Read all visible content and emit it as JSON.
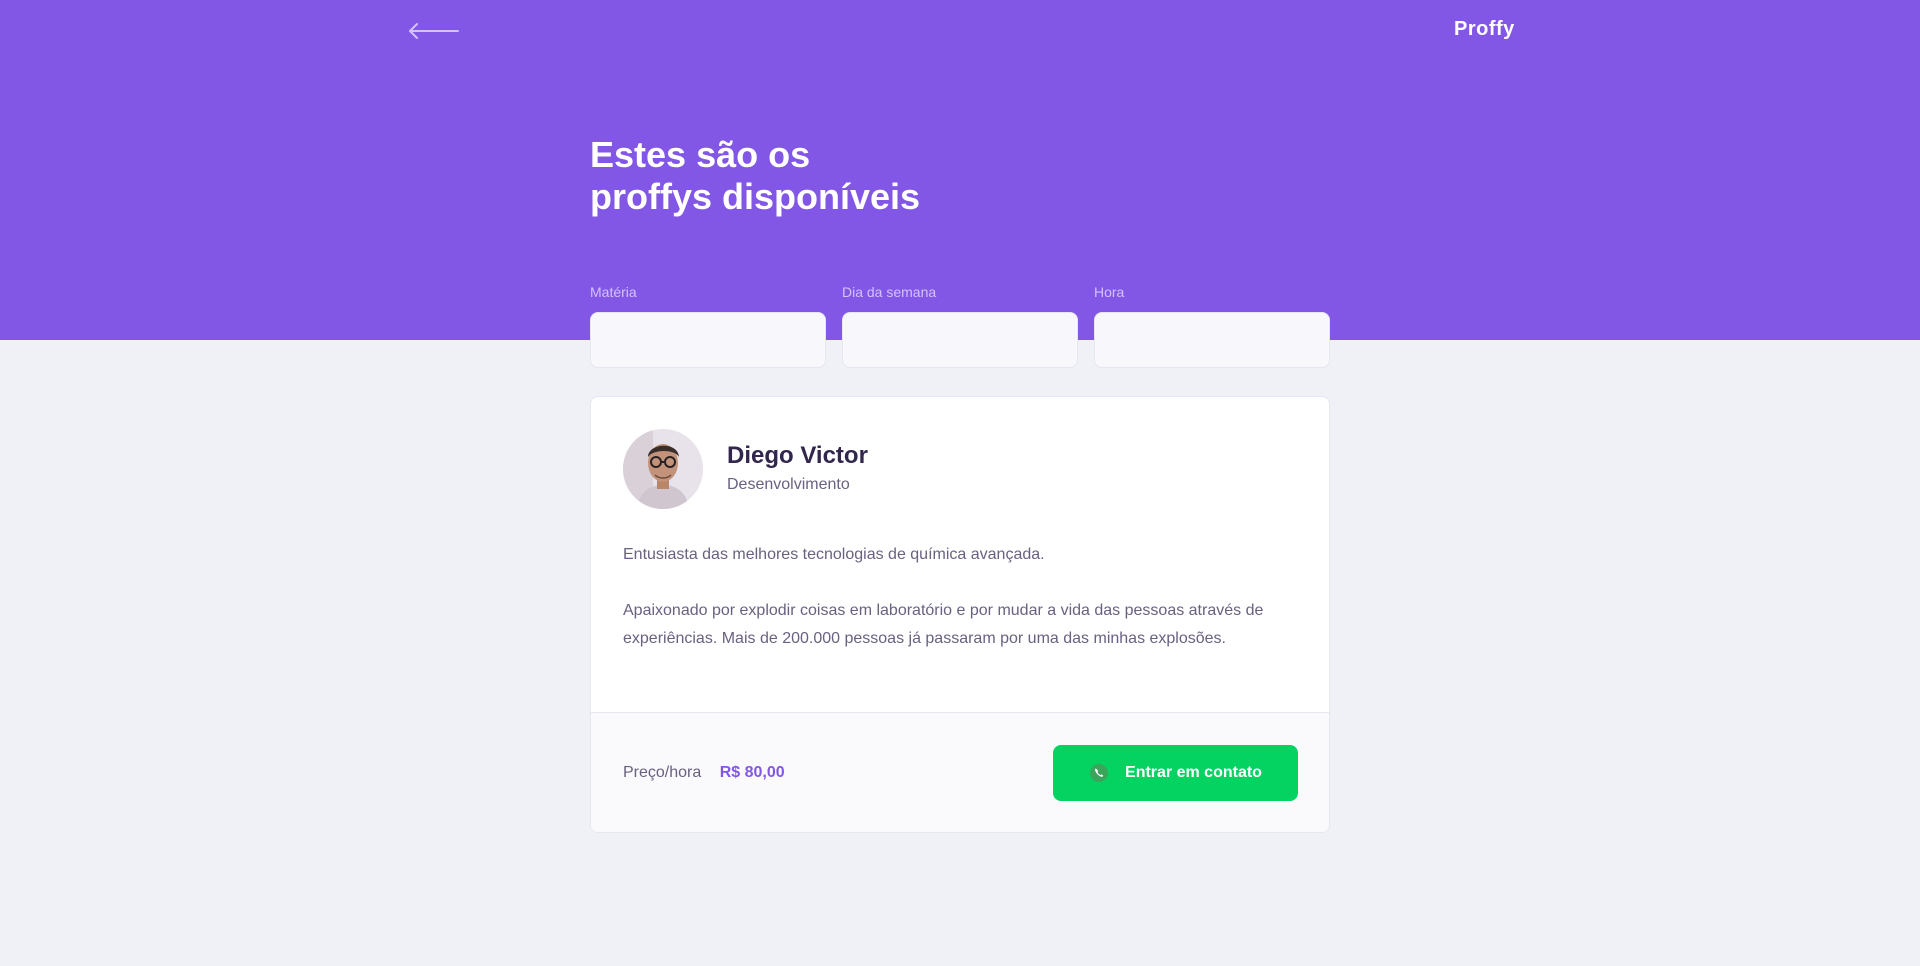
{
  "colors": {
    "primary": "#8257E5",
    "primary_light": "#D4C2FF",
    "background": "#F0F0F7",
    "title": "#32264D",
    "text": "#6A6180",
    "secondary": "#04D361"
  },
  "header": {
    "back_icon": "arrow-left-icon",
    "logo": "Proffy",
    "title_line1": "Estes são os",
    "title_line2": "proffys disponíveis"
  },
  "filters": {
    "subject_label": "Matéria",
    "weekday_label": "Dia da semana",
    "time_label": "Hora"
  },
  "teacher": {
    "name": "Diego Victor",
    "subject": "Desenvolvimento",
    "bio_paragraph1": "Entusiasta das melhores tecnologias de química avançada.",
    "bio_paragraph2": "Apaixonado por explodir coisas em laboratório e por mudar a vida das pessoas através de experiências. Mais de 200.000 pessoas já passaram por uma das minhas explosões.",
    "price_label": "Preço/hora",
    "price_value": "R$ 80,00",
    "contact_label": "Entrar em contato",
    "contact_icon": "whatsapp-icon"
  }
}
